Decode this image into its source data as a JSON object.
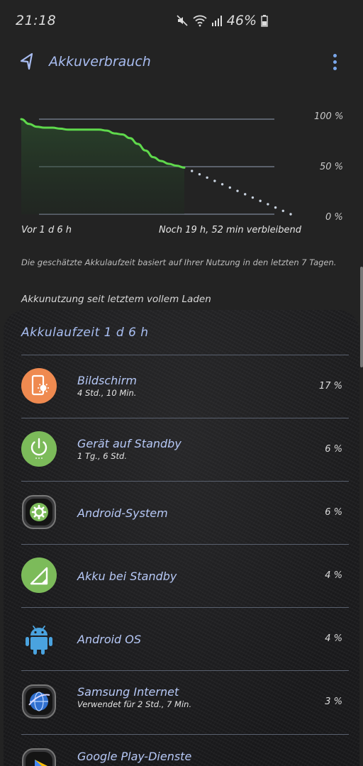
{
  "status": {
    "time": "21:18",
    "battery": "46%"
  },
  "header": {
    "title": "Akkuverbrauch"
  },
  "chart_data": {
    "type": "line",
    "y_ticks": [
      "100 %",
      "50 %",
      "0 %"
    ],
    "x_start_label": "Vor 1 d 6 h",
    "x_end_label": "Noch 19 h, 52 min verbleibend",
    "ylim": [
      0,
      100
    ],
    "colors": {
      "actual": "#5fd94c",
      "projection": "#c9d3e0",
      "grid": "#7d8699"
    },
    "series": [
      {
        "values": [
          100,
          95,
          92,
          91,
          91,
          90,
          89,
          89,
          89,
          89,
          89,
          88,
          85,
          84,
          80,
          74,
          67,
          60,
          56,
          53,
          51,
          49
        ]
      },
      {
        "values": [
          49,
          0
        ]
      }
    ]
  },
  "note": "Die geschätzte Akkulaufzeit basiert auf Ihrer Nutzung in den letzten 7 Tagen.",
  "section": {
    "heading": "Akkunutzung seit letztem vollem Laden"
  },
  "panel": {
    "title": "Akkulaufzeit 1 d 6 h",
    "items": [
      {
        "name": "Bildschirm",
        "sub": "4 Std., 10 Min.",
        "pct": "17 %",
        "icon": "screen-icon"
      },
      {
        "name": "Gerät auf Standby",
        "sub": "1 Tg., 6 Std.",
        "pct": "6 %",
        "icon": "power-icon"
      },
      {
        "name": "Android-System",
        "sub": "",
        "pct": "6 %",
        "icon": "gear-icon"
      },
      {
        "name": "Akku bei Standby",
        "sub": "",
        "pct": "4 %",
        "icon": "signal-icon"
      },
      {
        "name": "Android OS",
        "sub": "",
        "pct": "4 %",
        "icon": "android-icon"
      },
      {
        "name": "Samsung Internet",
        "sub": "Verwendet für 2 Std., 7 Min.",
        "pct": "3 %",
        "icon": "globe-icon"
      },
      {
        "name": "Google Play-Dienste",
        "sub": "",
        "pct": "",
        "icon": "play-services-icon"
      }
    ]
  }
}
